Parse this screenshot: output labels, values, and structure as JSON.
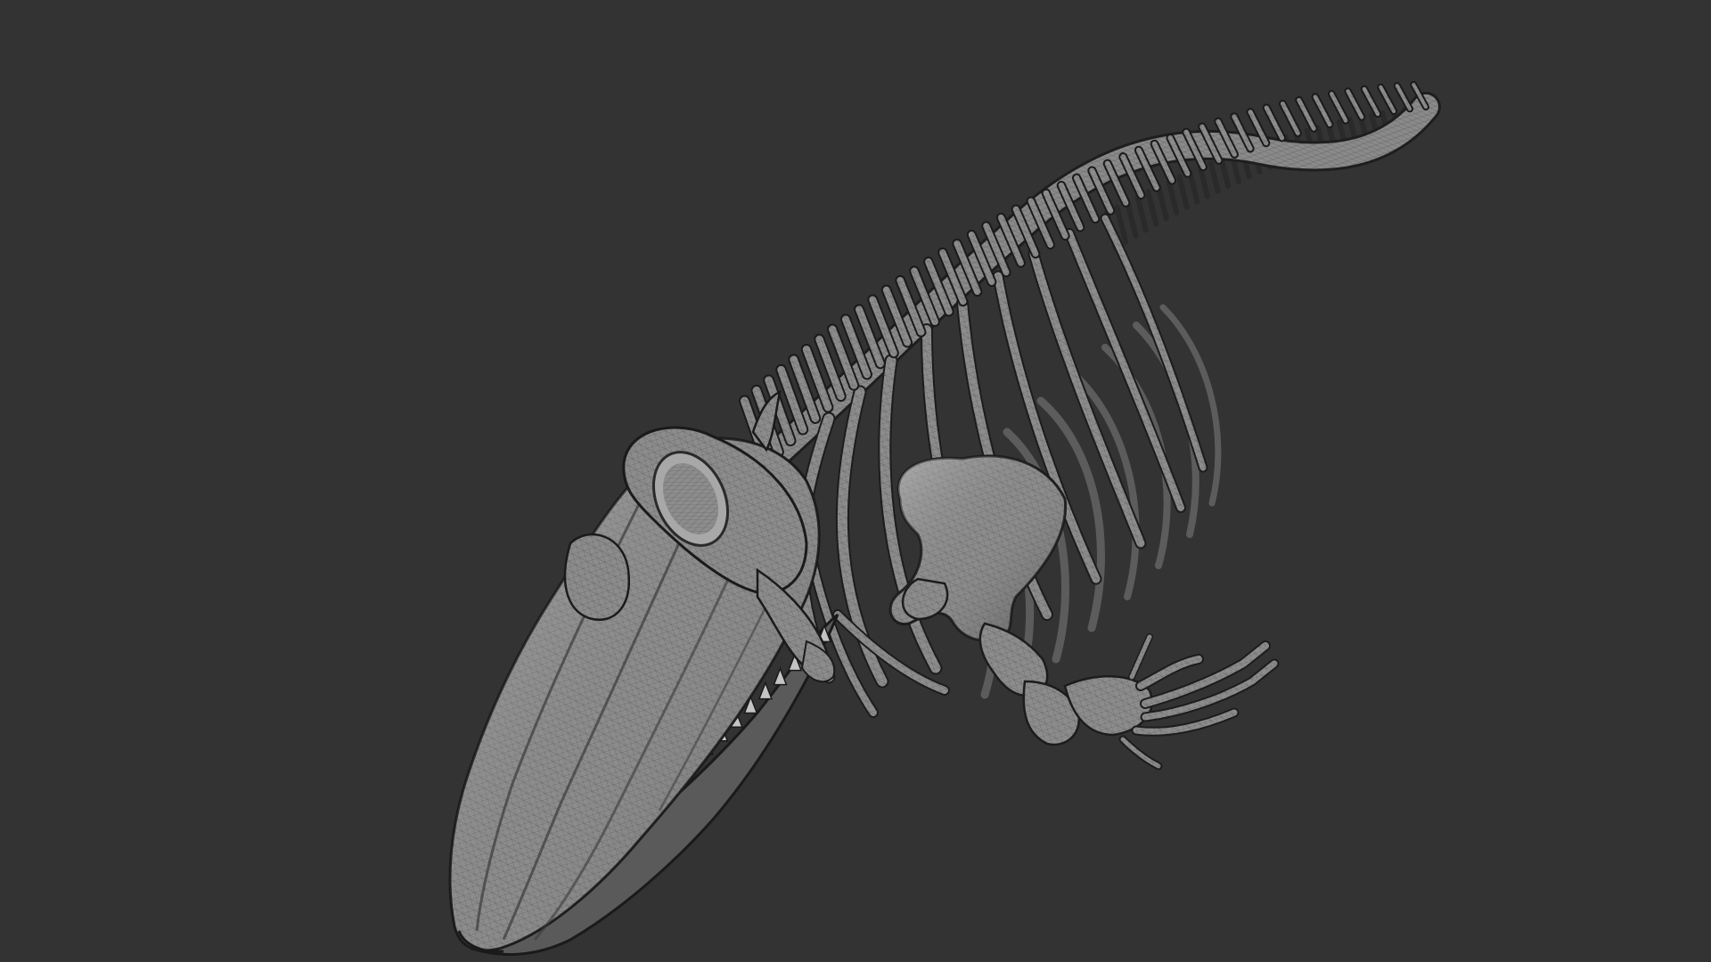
{
  "scene": {
    "subject": "whale-skeleton-wireframe-render",
    "colors": {
      "background": "#333333",
      "bone_fill": "#8e8e8e",
      "bone_light": "#bdbdbd",
      "bone_dark": "#5a5a5a",
      "wire": "#3a3a3a",
      "outline": "#1c1c1c"
    }
  }
}
